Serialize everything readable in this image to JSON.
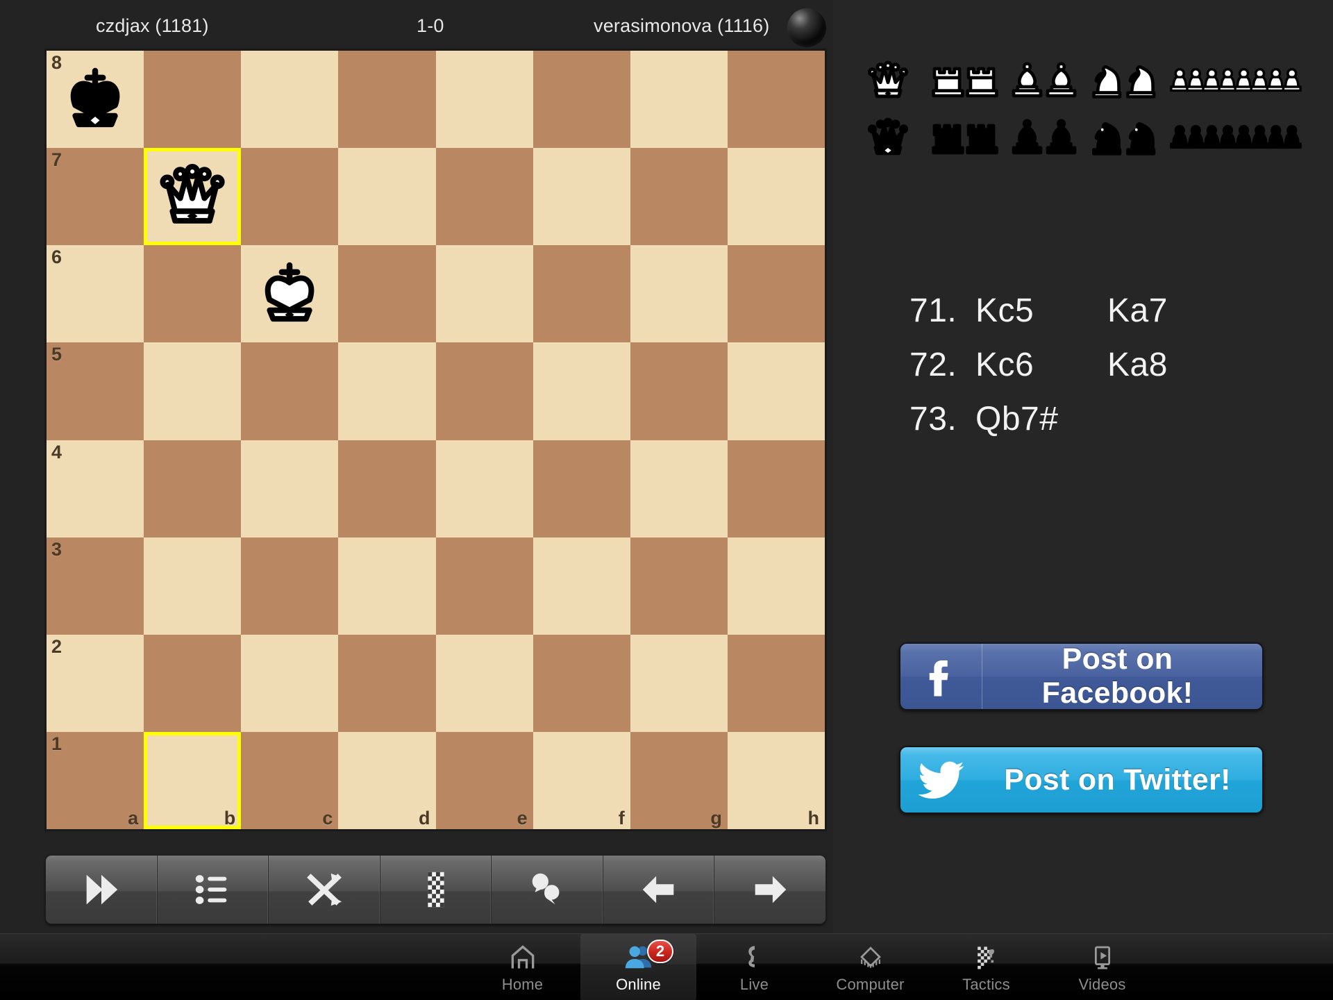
{
  "header": {
    "white_player": "czdjax (1181)",
    "black_player": "verasimonova (1116)",
    "result": "1-0",
    "turn_indicator": "black-sphere"
  },
  "board": {
    "light_color": "#efdbb4",
    "dark_color": "#b98863",
    "highlight_color": "#ffff00",
    "rank_labels": [
      "8",
      "7",
      "6",
      "5",
      "4",
      "3",
      "2",
      "1"
    ],
    "file_labels": [
      "a",
      "b",
      "c",
      "d",
      "e",
      "f",
      "g",
      "h"
    ],
    "orientation": "white",
    "highlighted_squares": [
      "b7",
      "b1"
    ],
    "pieces": [
      {
        "square": "a8",
        "piece": "king",
        "color": "black"
      },
      {
        "square": "b7",
        "piece": "queen",
        "color": "white"
      },
      {
        "square": "c6",
        "piece": "king",
        "color": "white"
      }
    ]
  },
  "captured": {
    "white_row": [
      {
        "piece": "queen",
        "count": 1
      },
      {
        "piece": "rook",
        "count": 2
      },
      {
        "piece": "bishop",
        "count": 2
      },
      {
        "piece": "knight",
        "count": 2
      },
      {
        "piece": "pawn",
        "count": 8
      }
    ],
    "black_row": [
      {
        "piece": "queen",
        "count": 1
      },
      {
        "piece": "rook",
        "count": 2
      },
      {
        "piece": "bishop",
        "count": 2
      },
      {
        "piece": "knight",
        "count": 2
      },
      {
        "piece": "pawn",
        "count": 8
      }
    ]
  },
  "moves": [
    {
      "number": "71.",
      "white": "Kc5",
      "black": "Ka7"
    },
    {
      "number": "72.",
      "white": "Kc6",
      "black": "Ka8"
    },
    {
      "number": "73.",
      "white": "Qb7#",
      "black": ""
    }
  ],
  "toolbar": {
    "buttons": [
      {
        "name": "fast-forward-icon",
        "label": "Fast forward"
      },
      {
        "name": "list-icon",
        "label": "Move list"
      },
      {
        "name": "shuffle-icon",
        "label": "Flip board"
      },
      {
        "name": "board-icon",
        "label": "Board settings"
      },
      {
        "name": "chat-icon",
        "label": "Chat"
      },
      {
        "name": "arrow-left-icon",
        "label": "Previous move"
      },
      {
        "name": "arrow-right-icon",
        "label": "Next move"
      }
    ]
  },
  "social": {
    "facebook_label": "Post on Facebook!",
    "facebook_color": "#4a63a0",
    "twitter_label": "Post on Twitter!",
    "twitter_color": "#2eaddf"
  },
  "tabbar": {
    "tabs": [
      {
        "label": "Home",
        "icon": "home-icon",
        "active": false,
        "badge": ""
      },
      {
        "label": "Online",
        "icon": "people-icon",
        "active": true,
        "badge": "2"
      },
      {
        "label": "Live",
        "icon": "live-icon",
        "active": false,
        "badge": ""
      },
      {
        "label": "Computer",
        "icon": "chip-icon",
        "active": false,
        "badge": ""
      },
      {
        "label": "Tactics",
        "icon": "tactics-icon",
        "active": false,
        "badge": ""
      },
      {
        "label": "Videos",
        "icon": "video-icon",
        "active": false,
        "badge": ""
      }
    ]
  }
}
